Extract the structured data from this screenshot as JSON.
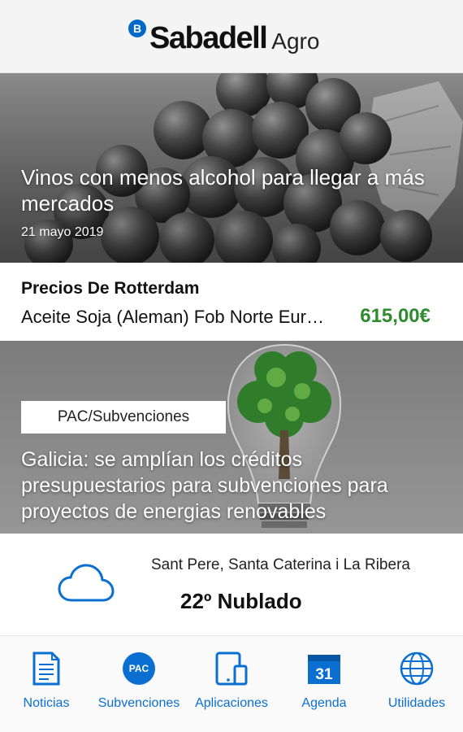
{
  "header": {
    "brand_mark": "B",
    "brand_name": "Sabadell",
    "brand_sub": "Agro"
  },
  "featured_news": {
    "title": "Vinos con menos alcohol para llegar a más mercados",
    "date": "21 mayo 2019"
  },
  "prices": {
    "title": "Precios De Rotterdam",
    "item": "Aceite Soja (Aleman) Fob Norte Europa",
    "value": "615,00€",
    "value_color": "#2e8b2e"
  },
  "second_news": {
    "tag": "PAC/Subvenciones",
    "title": "Galicia: se amplían los créditos presupuestarios para subvenciones para proyectos de energias renovables"
  },
  "weather": {
    "location": "Sant Pere, Santa Caterina i La Ribera",
    "temperature": "22º Nublado",
    "icon": "cloud-icon"
  },
  "nav": {
    "accent_color": "#0a6fd0",
    "items": [
      {
        "label": "Noticias",
        "icon": "document-icon"
      },
      {
        "label": "Subvenciones",
        "icon": "pac-icon",
        "badge": "PAC"
      },
      {
        "label": "Aplicaciones",
        "icon": "devices-icon"
      },
      {
        "label": "Agenda",
        "icon": "calendar-icon",
        "badge": "31"
      },
      {
        "label": "Utilidades",
        "icon": "globe-icon"
      }
    ]
  }
}
